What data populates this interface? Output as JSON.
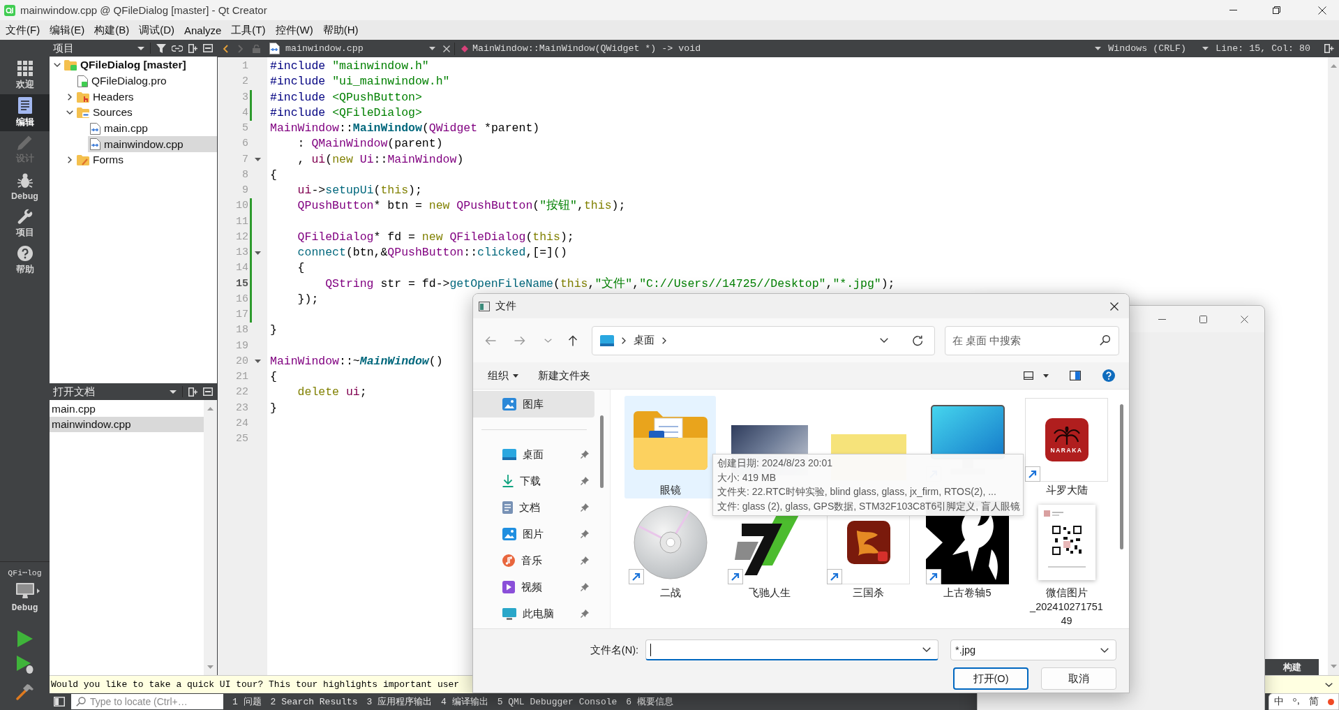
{
  "window": {
    "title": "mainwindow.cpp @ QFileDialog [master] - Qt Creator"
  },
  "menu_bar": [
    "文件(F)",
    "编辑(E)",
    "构建(B)",
    "调试(D)",
    "Analyze",
    "工具(T)",
    "控件(W)",
    "帮助(H)"
  ],
  "mode_bar": {
    "modes": [
      {
        "kind": "welcome",
        "label": "欢迎",
        "selected": false,
        "disabled": false
      },
      {
        "kind": "edit",
        "label": "编辑",
        "selected": true,
        "disabled": false
      },
      {
        "kind": "design",
        "label": "设计",
        "selected": false,
        "disabled": true
      },
      {
        "kind": "debug",
        "label": "Debug",
        "selected": false,
        "disabled": false
      },
      {
        "kind": "projects",
        "label": "项目",
        "selected": false,
        "disabled": false
      },
      {
        "kind": "help",
        "label": "帮助",
        "selected": false,
        "disabled": false
      }
    ],
    "target": {
      "project": "QFi⋯log",
      "build": "Debug"
    }
  },
  "project_panel": {
    "title": "项目",
    "tree": [
      {
        "kind": "project",
        "label": "QFileDialog [master]",
        "expanded": true,
        "selected": false,
        "children": [
          {
            "kind": "pro",
            "label": "QFileDialog.pro",
            "selected": false
          },
          {
            "kind": "headers",
            "label": "Headers",
            "expanded": false,
            "selected": false
          },
          {
            "kind": "sources",
            "label": "Sources",
            "expanded": true,
            "selected": false,
            "children": [
              {
                "kind": "cpp",
                "label": "main.cpp",
                "selected": false
              },
              {
                "kind": "cpp",
                "label": "mainwindow.cpp",
                "selected": true
              }
            ]
          },
          {
            "kind": "forms",
            "label": "Forms",
            "expanded": false,
            "selected": false
          }
        ]
      }
    ]
  },
  "open_documents": {
    "title": "打开文档",
    "items": [
      {
        "label": "main.cpp",
        "selected": false
      },
      {
        "label": "mainwindow.cpp",
        "selected": true
      }
    ]
  },
  "editor": {
    "file": "mainwindow.cpp",
    "symbol": "MainWindow::MainWindow(QWidget *) -> void",
    "line_ending": "Windows (CRLF)",
    "position": "Line: 15, Col: 80",
    "lines": [
      {
        "number": "1",
        "changed": false,
        "foldable": false,
        "current": false,
        "tokens": [
          {
            "kind": "preproc",
            "text": "#include "
          },
          {
            "kind": "string",
            "text": "\"mainwindow.h\""
          }
        ]
      },
      {
        "number": "2",
        "changed": false,
        "foldable": false,
        "current": false,
        "tokens": [
          {
            "kind": "preproc",
            "text": "#include "
          },
          {
            "kind": "string",
            "text": "\"ui_mainwindow.h\""
          }
        ]
      },
      {
        "number": "3",
        "changed": true,
        "foldable": false,
        "current": false,
        "tokens": [
          {
            "kind": "preproc",
            "text": "#include "
          },
          {
            "kind": "string",
            "text": "<QPushButton>"
          }
        ]
      },
      {
        "number": "4",
        "changed": true,
        "foldable": false,
        "current": false,
        "tokens": [
          {
            "kind": "preproc",
            "text": "#include "
          },
          {
            "kind": "string",
            "text": "<QFileDialog>"
          }
        ]
      },
      {
        "number": "5",
        "changed": false,
        "foldable": false,
        "current": false,
        "tokens": [
          {
            "kind": "type",
            "text": "MainWindow"
          },
          {
            "kind": "plain",
            "text": "::"
          },
          {
            "kind": "decl",
            "text": "MainWindow"
          },
          {
            "kind": "plain",
            "text": "("
          },
          {
            "kind": "type",
            "text": "QWidget"
          },
          {
            "kind": "plain",
            "text": " *parent)"
          }
        ]
      },
      {
        "number": "6",
        "changed": false,
        "foldable": false,
        "current": false,
        "tokens": [
          {
            "kind": "plain",
            "text": "    : "
          },
          {
            "kind": "type",
            "text": "QMainWindow"
          },
          {
            "kind": "plain",
            "text": "(parent)"
          }
        ]
      },
      {
        "number": "7",
        "changed": false,
        "foldable": true,
        "current": false,
        "tokens": [
          {
            "kind": "plain",
            "text": "    , "
          },
          {
            "kind": "field",
            "text": "ui"
          },
          {
            "kind": "plain",
            "text": "("
          },
          {
            "kind": "keyword",
            "text": "new"
          },
          {
            "kind": "type",
            "text": " Ui"
          },
          {
            "kind": "plain",
            "text": "::"
          },
          {
            "kind": "type",
            "text": "MainWindow"
          },
          {
            "kind": "plain",
            "text": ")"
          }
        ]
      },
      {
        "number": "8",
        "changed": false,
        "foldable": false,
        "current": false,
        "tokens": [
          {
            "kind": "plain",
            "text": "{"
          }
        ]
      },
      {
        "number": "9",
        "changed": false,
        "foldable": false,
        "current": false,
        "tokens": [
          {
            "kind": "field",
            "text": "    ui"
          },
          {
            "kind": "plain",
            "text": "->"
          },
          {
            "kind": "func",
            "text": "setupUi"
          },
          {
            "kind": "plain",
            "text": "("
          },
          {
            "kind": "keyword",
            "text": "this"
          },
          {
            "kind": "plain",
            "text": ");"
          }
        ]
      },
      {
        "number": "10",
        "changed": true,
        "foldable": false,
        "current": false,
        "tokens": [
          {
            "kind": "type",
            "text": "    QPushButton"
          },
          {
            "kind": "plain",
            "text": "* btn = "
          },
          {
            "kind": "keyword",
            "text": "new"
          },
          {
            "kind": "type",
            "text": " QPushButton"
          },
          {
            "kind": "plain",
            "text": "("
          },
          {
            "kind": "string",
            "text": "\"按钮\""
          },
          {
            "kind": "plain",
            "text": ","
          },
          {
            "kind": "keyword",
            "text": "this"
          },
          {
            "kind": "plain",
            "text": ");"
          }
        ]
      },
      {
        "number": "11",
        "changed": true,
        "foldable": false,
        "current": false
      },
      {
        "number": "12",
        "changed": true,
        "foldable": false,
        "current": false,
        "tokens": [
          {
            "kind": "type",
            "text": "    QFileDialog"
          },
          {
            "kind": "plain",
            "text": "* fd = "
          },
          {
            "kind": "keyword",
            "text": "new"
          },
          {
            "kind": "type",
            "text": " QFileDialog"
          },
          {
            "kind": "plain",
            "text": "("
          },
          {
            "kind": "keyword",
            "text": "this"
          },
          {
            "kind": "plain",
            "text": ");"
          }
        ]
      },
      {
        "number": "13",
        "changed": true,
        "foldable": true,
        "current": false,
        "tokens": [
          {
            "kind": "func",
            "text": "    connect"
          },
          {
            "kind": "plain",
            "text": "(btn,&"
          },
          {
            "kind": "type",
            "text": "QPushButton"
          },
          {
            "kind": "plain",
            "text": "::"
          },
          {
            "kind": "func",
            "text": "clicked"
          },
          {
            "kind": "plain",
            "text": ",[=]()"
          }
        ]
      },
      {
        "number": "14",
        "changed": true,
        "foldable": false,
        "current": false,
        "tokens": [
          {
            "kind": "plain",
            "text": "    {"
          }
        ]
      },
      {
        "number": "15",
        "changed": true,
        "foldable": false,
        "current": true,
        "tokens": [
          {
            "kind": "type",
            "text": "        QString"
          },
          {
            "kind": "plain",
            "text": " str = fd->"
          },
          {
            "kind": "func",
            "text": "getOpenFileName"
          },
          {
            "kind": "plain",
            "text": "("
          },
          {
            "kind": "keyword",
            "text": "this"
          },
          {
            "kind": "plain",
            "text": ","
          },
          {
            "kind": "string",
            "text": "\"文件\""
          },
          {
            "kind": "plain",
            "text": ","
          },
          {
            "kind": "string",
            "text": "\"C://Users//14725//Desktop\""
          },
          {
            "kind": "plain",
            "text": ","
          },
          {
            "kind": "string",
            "text": "\"*.jpg\""
          },
          {
            "kind": "plain",
            "text": ");"
          }
        ]
      },
      {
        "number": "16",
        "changed": true,
        "foldable": false,
        "current": false,
        "tokens": [
          {
            "kind": "plain",
            "text": "    });"
          }
        ]
      },
      {
        "number": "17",
        "changed": true,
        "foldable": false,
        "current": false
      },
      {
        "number": "18",
        "changed": false,
        "foldable": false,
        "current": false,
        "tokens": [
          {
            "kind": "plain",
            "text": "}"
          }
        ]
      },
      {
        "number": "19",
        "changed": false,
        "foldable": false,
        "current": false
      },
      {
        "number": "20",
        "changed": false,
        "foldable": true,
        "current": false,
        "tokens": [
          {
            "kind": "type",
            "text": "MainWindow"
          },
          {
            "kind": "plain",
            "text": "::~"
          },
          {
            "kind": "virtual_decl",
            "text": "MainWindow"
          },
          {
            "kind": "plain",
            "text": "()"
          }
        ]
      },
      {
        "number": "21",
        "changed": false,
        "foldable": false,
        "current": false,
        "tokens": [
          {
            "kind": "plain",
            "text": "{"
          }
        ]
      },
      {
        "number": "22",
        "changed": false,
        "foldable": false,
        "current": false,
        "tokens": [
          {
            "kind": "keyword",
            "text": "    delete"
          },
          {
            "kind": "field",
            "text": " ui"
          },
          {
            "kind": "plain",
            "text": ";"
          }
        ]
      },
      {
        "number": "23",
        "changed": false,
        "foldable": false,
        "current": false,
        "tokens": [
          {
            "kind": "plain",
            "text": "}"
          }
        ]
      },
      {
        "number": "24",
        "changed": false,
        "foldable": false,
        "current": false
      },
      {
        "number": "25",
        "changed": false,
        "foldable": false,
        "current": false
      }
    ]
  },
  "tour_bar": {
    "text": "Would you like to take a quick UI tour? This tour highlights important user"
  },
  "build_tab": "构建",
  "status_bar": {
    "locator_placeholder": "Type to locate (Ctrl+…",
    "panes": [
      "1 问题",
      "2 Search Results",
      "3 应用程序输出",
      "4 编译输出",
      "5 QML Debugger Console",
      "6 概要信息"
    ]
  },
  "file_dialog": {
    "title": "文件",
    "breadcrumbs": [
      "桌面"
    ],
    "search_placeholder": "在 桌面 中搜索",
    "commands": [
      {
        "kind": "menu",
        "label": "组织"
      },
      {
        "kind": "button",
        "label": "新建文件夹"
      }
    ],
    "nav_groups": [
      {
        "items": [
          {
            "kind": "gallery",
            "label": "图库",
            "selected": true,
            "pinned": false
          }
        ]
      },
      {
        "items": [
          {
            "kind": "desktop",
            "label": "桌面",
            "selected": false,
            "pinned": true
          },
          {
            "kind": "downloads",
            "label": "下载",
            "selected": false,
            "pinned": true
          },
          {
            "kind": "documents",
            "label": "文档",
            "selected": false,
            "pinned": true
          },
          {
            "kind": "pictures",
            "label": "图片",
            "selected": false,
            "pinned": true
          },
          {
            "kind": "music",
            "label": "音乐",
            "selected": false,
            "pinned": true
          },
          {
            "kind": "videos",
            "label": "视频",
            "selected": false,
            "pinned": true
          },
          {
            "kind": "computer",
            "label": "此电脑",
            "selected": false,
            "pinned": true
          }
        ]
      }
    ],
    "items": [
      {
        "kind": "folder",
        "name": "眼镜",
        "selected": true,
        "shortcut": false
      },
      {
        "kind": "photo",
        "selected": false,
        "shortcut": false
      },
      {
        "kind": "picture",
        "selected": false,
        "shortcut": false
      },
      {
        "kind": "monitor",
        "selected": false,
        "shortcut": true
      },
      {
        "kind": "app",
        "name": "斗罗大陆",
        "badge": "NARAKA",
        "selected": false,
        "shortcut": true
      },
      {
        "kind": "disc",
        "name": "二战",
        "selected": false,
        "shortcut": true
      },
      {
        "kind": "logo",
        "name": "飞驰人生",
        "selected": false,
        "shortcut": true
      },
      {
        "kind": "game",
        "name": "三国杀",
        "selected": false,
        "shortcut": true
      },
      {
        "kind": "emblem",
        "name": "上古卷轴5",
        "selected": false,
        "shortcut": true
      },
      {
        "kind": "qr",
        "name": "微信图片_20241027175149",
        "selected": false,
        "shortcut": false
      }
    ],
    "tooltip": [
      "创建日期: 2024/8/23 20:01",
      "大小: 419 MB",
      "文件夹: 22.RTC时钟实验, blind glass, glass, jx_firm, RTOS(2), ...",
      "文件: glass (2), glass, GPS数据, STM32F103C8T6引脚定义, 盲人眼镜"
    ],
    "file_name_label": "文件名(N):",
    "file_name_focused": true,
    "file_type": "*.jpg",
    "buttons": [
      {
        "kind": "primary",
        "label": "打开(O)"
      },
      {
        "kind": "secondary",
        "label": "取消"
      }
    ]
  },
  "ime_bar": {
    "mode": "中",
    "script": "简"
  }
}
